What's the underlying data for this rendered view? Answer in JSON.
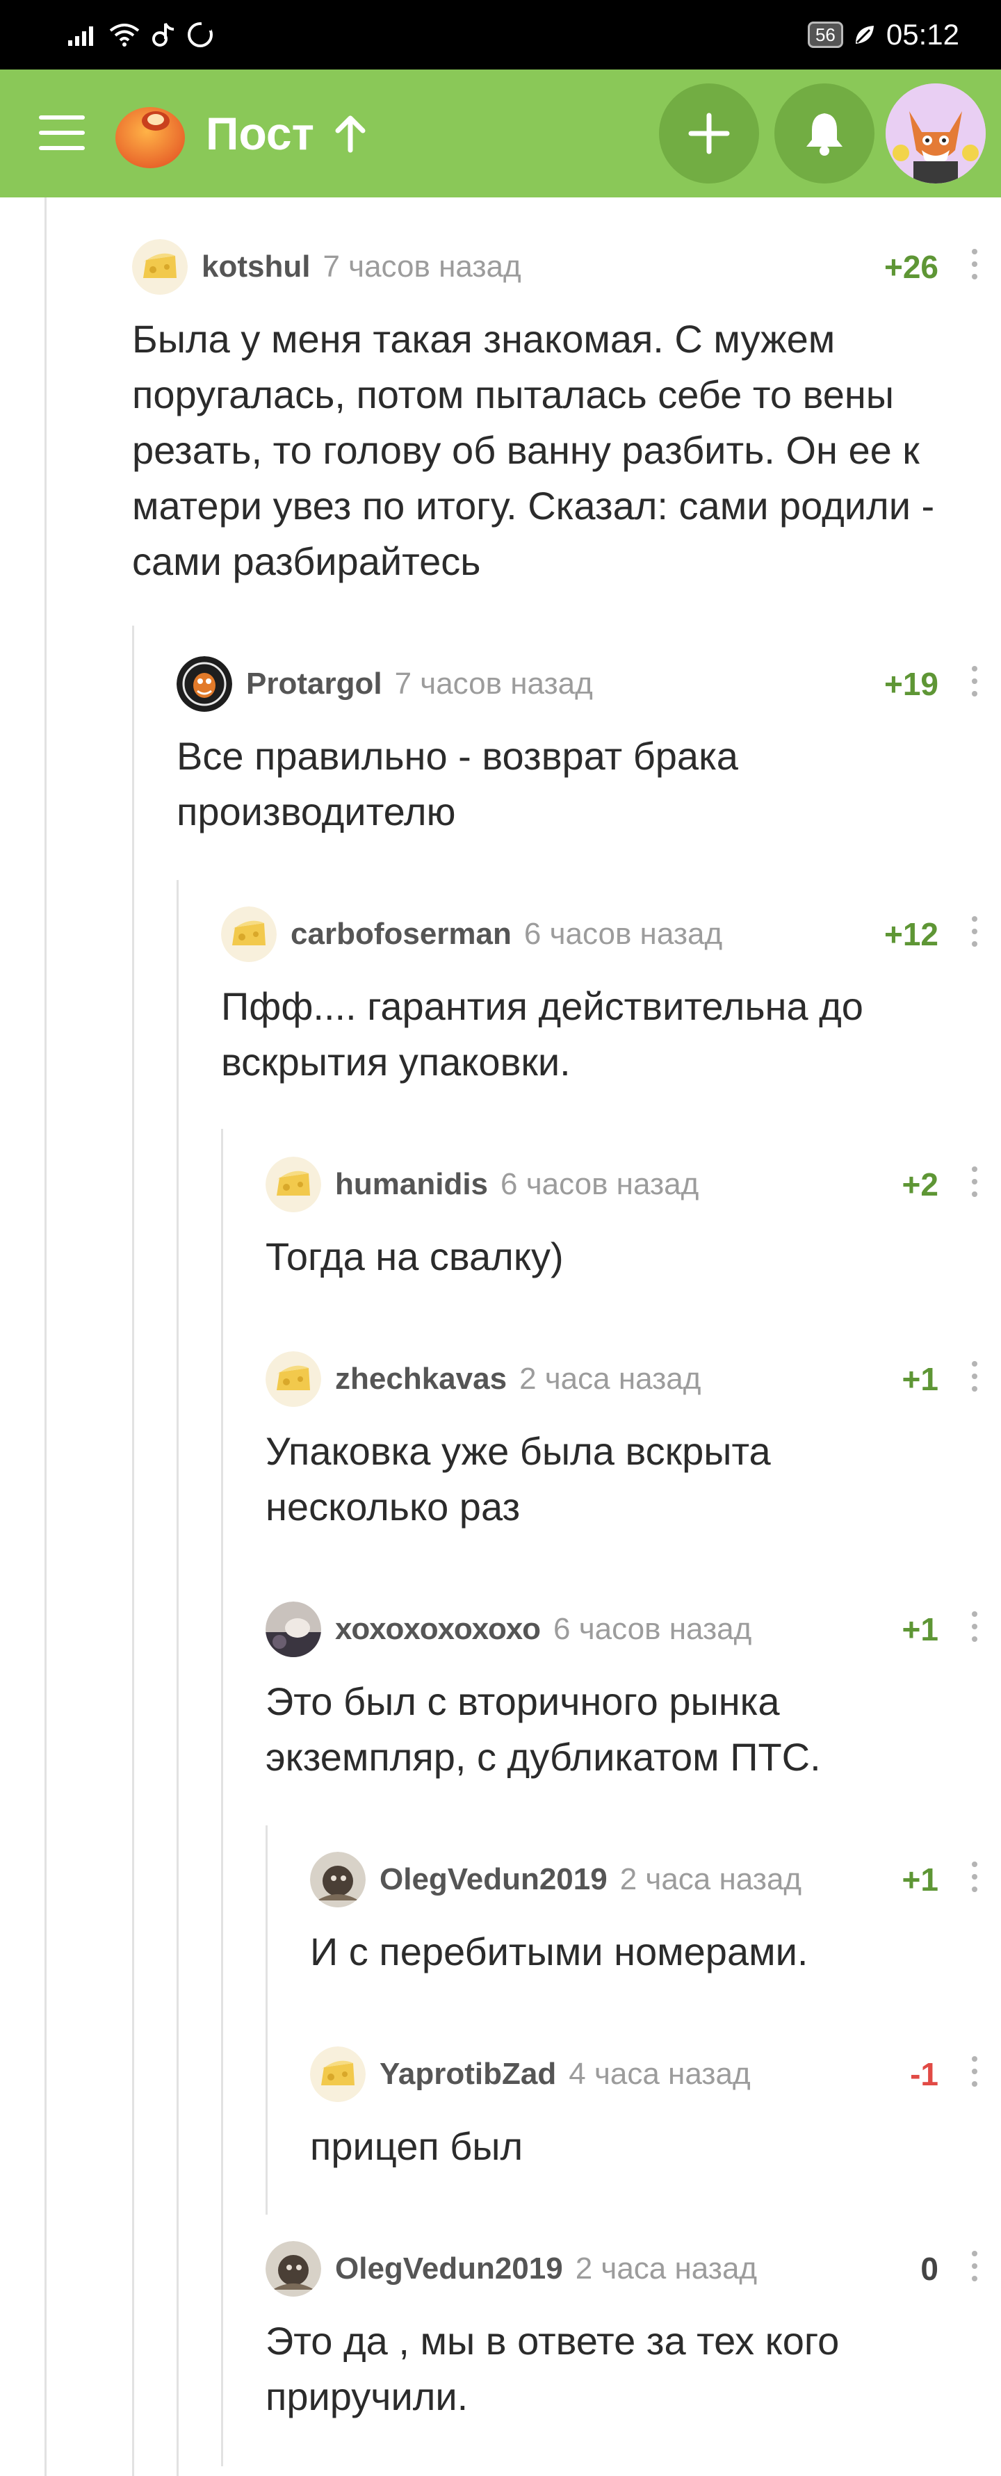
{
  "status_bar": {
    "battery": "56",
    "time": "05:12"
  },
  "header": {
    "title": "Пост"
  },
  "colors": {
    "header_bg": "#8ac858",
    "header_button": "#72ad43",
    "positive_rating": "#5e9635",
    "negative_rating": "#e14a45"
  },
  "comments": [
    {
      "author": "kotshul",
      "time": "7 часов назад",
      "rating": "+26",
      "text": "Была у меня такая знакомая. С мужем поругалась, потом пыталась себе то вены резать, то голову об ванну разбить. Он ее к матери увез по итогу. Сказал: сами родили - сами разбирайтесь"
    },
    {
      "author": "Protargol",
      "time": "7 часов назад",
      "rating": "+19",
      "text": "Все правильно - возврат брака производителю"
    },
    {
      "author": "carbofoserman",
      "time": "6 часов назад",
      "rating": "+12",
      "text": "Пфф.... гарантия действительна до вскрытия упаковки."
    },
    {
      "author": "humanidis",
      "time": "6 часов назад",
      "rating": "+2",
      "text": "Тогда на свалку)"
    },
    {
      "author": "zhechkavas",
      "time": "2 часа назад",
      "rating": "+1",
      "text": "Упаковка уже была вскрыта несколько раз"
    },
    {
      "author": "хохохохохохо",
      "time": "6 часов назад",
      "rating": "+1",
      "text": "Это был с вторичного рынка экземпляр, с дубликатом ПТС."
    },
    {
      "author": "OlegVedun2019",
      "time": "2 часа назад",
      "rating": "+1",
      "text": "И с перебитыми номерами."
    },
    {
      "author": "YaprotibZad",
      "time": "4 часа назад",
      "rating": "-1",
      "text": "прицеп был"
    },
    {
      "author": "OlegVedun2019",
      "time": "2 часа назад",
      "rating": "0",
      "text": "Это да , мы в ответе за тех кого приручили."
    }
  ]
}
